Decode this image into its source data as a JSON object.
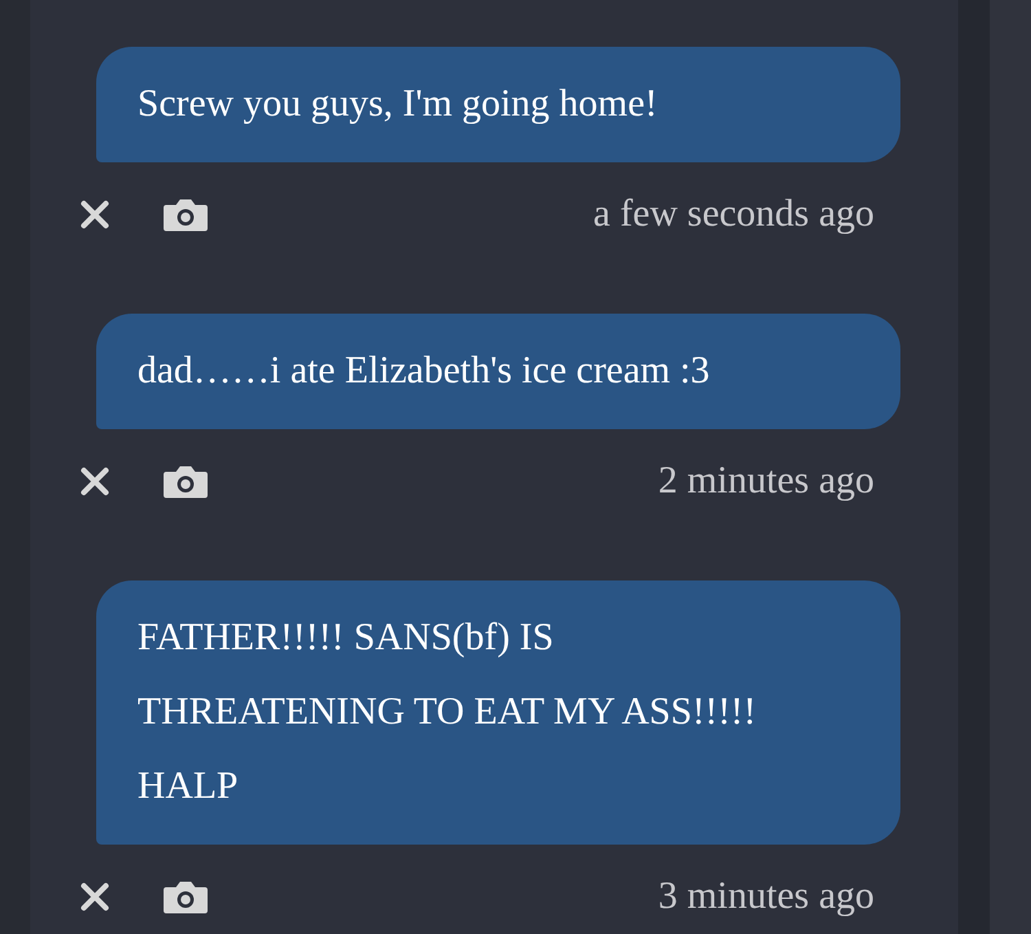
{
  "messages": [
    {
      "text": "Screw you guys, I'm going home!",
      "time": "a few seconds ago"
    },
    {
      "text": "dad……i ate Elizabeth's ice cream :3",
      "time": "2 minutes ago"
    },
    {
      "text": "FATHER!!!!! SANS(bf) IS THREATENING TO EAT MY ASS!!!!! HALP",
      "time": "3 minutes ago"
    }
  ]
}
